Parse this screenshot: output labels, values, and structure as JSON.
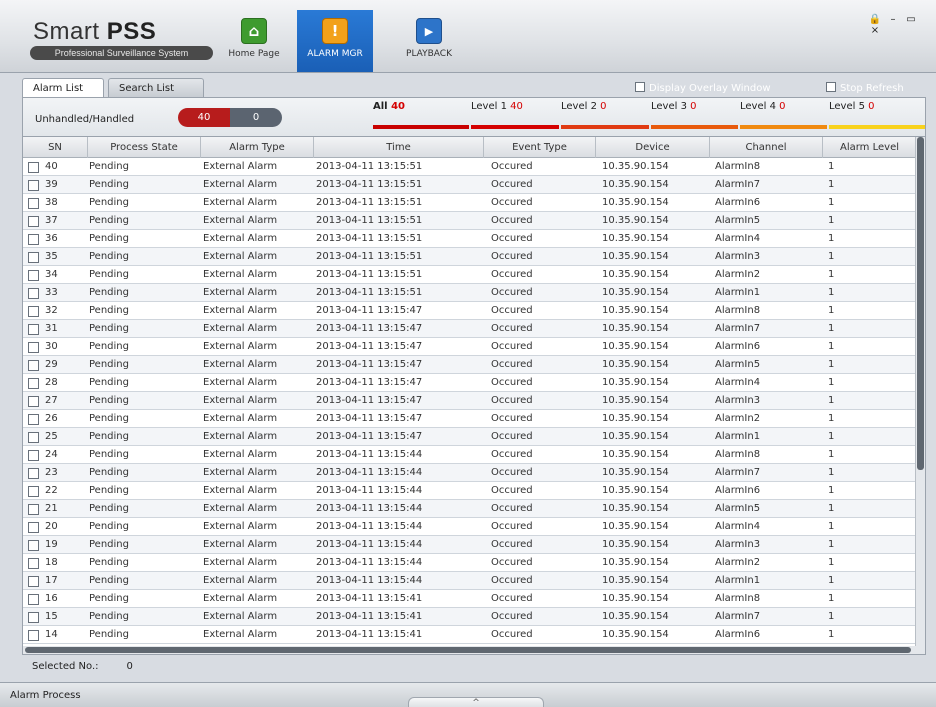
{
  "app": {
    "title_light": "Smart ",
    "title_bold": "PSS",
    "subtitle": "Professional Surveillance System"
  },
  "nav": [
    {
      "label": "Home Page",
      "icon": "home-icon",
      "active": false
    },
    {
      "label": "ALARM MGR",
      "icon": "alarm-warning-icon",
      "active": true
    },
    {
      "label": "PLAYBACK",
      "icon": "playback-icon",
      "active": false
    }
  ],
  "window_controls": {
    "lock": "🔒",
    "minimize": "–",
    "maximize": "▭",
    "close": "×"
  },
  "tabs": [
    {
      "label": "Alarm List",
      "active": true
    },
    {
      "label": "Search List",
      "active": false
    }
  ],
  "options": {
    "display_overlay": "Display Overlay Window",
    "stop_refresh": "Stop Refresh"
  },
  "filter": {
    "label": "Unhandled/Handled",
    "unhandled": "40",
    "handled": "0"
  },
  "levels": [
    {
      "label": "All ",
      "count": "40",
      "color": "#c80000"
    },
    {
      "label": "Level 1 ",
      "count": "40",
      "color": "#d40000"
    },
    {
      "label": "Level 2 ",
      "count": "0",
      "color": "#e03a12"
    },
    {
      "label": "Level 3 ",
      "count": "0",
      "color": "#e85a0c"
    },
    {
      "label": "Level 4 ",
      "count": "0",
      "color": "#f08a10"
    },
    {
      "label": "Level 5 ",
      "count": "0",
      "color": "#f8d21c"
    }
  ],
  "table": {
    "columns": [
      "SN",
      "Process State",
      "Alarm Type",
      "Time",
      "Event Type",
      "Device",
      "Channel",
      "Alarm Level"
    ],
    "rows": [
      [
        "40",
        "Pending",
        "External Alarm",
        "2013-04-11 13:15:51",
        "Occured",
        "10.35.90.154",
        "AlarmIn8",
        "1"
      ],
      [
        "39",
        "Pending",
        "External Alarm",
        "2013-04-11 13:15:51",
        "Occured",
        "10.35.90.154",
        "AlarmIn7",
        "1"
      ],
      [
        "38",
        "Pending",
        "External Alarm",
        "2013-04-11 13:15:51",
        "Occured",
        "10.35.90.154",
        "AlarmIn6",
        "1"
      ],
      [
        "37",
        "Pending",
        "External Alarm",
        "2013-04-11 13:15:51",
        "Occured",
        "10.35.90.154",
        "AlarmIn5",
        "1"
      ],
      [
        "36",
        "Pending",
        "External Alarm",
        "2013-04-11 13:15:51",
        "Occured",
        "10.35.90.154",
        "AlarmIn4",
        "1"
      ],
      [
        "35",
        "Pending",
        "External Alarm",
        "2013-04-11 13:15:51",
        "Occured",
        "10.35.90.154",
        "AlarmIn3",
        "1"
      ],
      [
        "34",
        "Pending",
        "External Alarm",
        "2013-04-11 13:15:51",
        "Occured",
        "10.35.90.154",
        "AlarmIn2",
        "1"
      ],
      [
        "33",
        "Pending",
        "External Alarm",
        "2013-04-11 13:15:51",
        "Occured",
        "10.35.90.154",
        "AlarmIn1",
        "1"
      ],
      [
        "32",
        "Pending",
        "External Alarm",
        "2013-04-11 13:15:47",
        "Occured",
        "10.35.90.154",
        "AlarmIn8",
        "1"
      ],
      [
        "31",
        "Pending",
        "External Alarm",
        "2013-04-11 13:15:47",
        "Occured",
        "10.35.90.154",
        "AlarmIn7",
        "1"
      ],
      [
        "30",
        "Pending",
        "External Alarm",
        "2013-04-11 13:15:47",
        "Occured",
        "10.35.90.154",
        "AlarmIn6",
        "1"
      ],
      [
        "29",
        "Pending",
        "External Alarm",
        "2013-04-11 13:15:47",
        "Occured",
        "10.35.90.154",
        "AlarmIn5",
        "1"
      ],
      [
        "28",
        "Pending",
        "External Alarm",
        "2013-04-11 13:15:47",
        "Occured",
        "10.35.90.154",
        "AlarmIn4",
        "1"
      ],
      [
        "27",
        "Pending",
        "External Alarm",
        "2013-04-11 13:15:47",
        "Occured",
        "10.35.90.154",
        "AlarmIn3",
        "1"
      ],
      [
        "26",
        "Pending",
        "External Alarm",
        "2013-04-11 13:15:47",
        "Occured",
        "10.35.90.154",
        "AlarmIn2",
        "1"
      ],
      [
        "25",
        "Pending",
        "External Alarm",
        "2013-04-11 13:15:47",
        "Occured",
        "10.35.90.154",
        "AlarmIn1",
        "1"
      ],
      [
        "24",
        "Pending",
        "External Alarm",
        "2013-04-11 13:15:44",
        "Occured",
        "10.35.90.154",
        "AlarmIn8",
        "1"
      ],
      [
        "23",
        "Pending",
        "External Alarm",
        "2013-04-11 13:15:44",
        "Occured",
        "10.35.90.154",
        "AlarmIn7",
        "1"
      ],
      [
        "22",
        "Pending",
        "External Alarm",
        "2013-04-11 13:15:44",
        "Occured",
        "10.35.90.154",
        "AlarmIn6",
        "1"
      ],
      [
        "21",
        "Pending",
        "External Alarm",
        "2013-04-11 13:15:44",
        "Occured",
        "10.35.90.154",
        "AlarmIn5",
        "1"
      ],
      [
        "20",
        "Pending",
        "External Alarm",
        "2013-04-11 13:15:44",
        "Occured",
        "10.35.90.154",
        "AlarmIn4",
        "1"
      ],
      [
        "19",
        "Pending",
        "External Alarm",
        "2013-04-11 13:15:44",
        "Occured",
        "10.35.90.154",
        "AlarmIn3",
        "1"
      ],
      [
        "18",
        "Pending",
        "External Alarm",
        "2013-04-11 13:15:44",
        "Occured",
        "10.35.90.154",
        "AlarmIn2",
        "1"
      ],
      [
        "17",
        "Pending",
        "External Alarm",
        "2013-04-11 13:15:44",
        "Occured",
        "10.35.90.154",
        "AlarmIn1",
        "1"
      ],
      [
        "16",
        "Pending",
        "External Alarm",
        "2013-04-11 13:15:41",
        "Occured",
        "10.35.90.154",
        "AlarmIn8",
        "1"
      ],
      [
        "15",
        "Pending",
        "External Alarm",
        "2013-04-11 13:15:41",
        "Occured",
        "10.35.90.154",
        "AlarmIn7",
        "1"
      ],
      [
        "14",
        "Pending",
        "External Alarm",
        "2013-04-11 13:15:41",
        "Occured",
        "10.35.90.154",
        "AlarmIn6",
        "1"
      ]
    ]
  },
  "selected": {
    "label": "Selected No.:",
    "value": "0"
  },
  "footer": {
    "label": "Alarm Process",
    "toggle": "^"
  }
}
